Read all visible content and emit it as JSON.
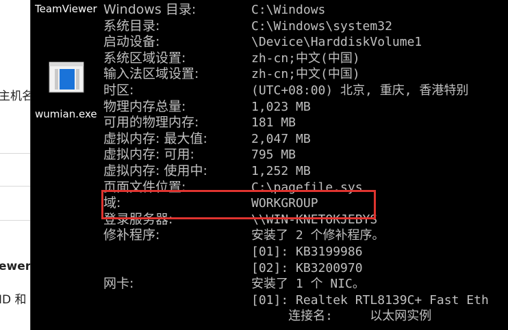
{
  "left_panel": {
    "snippets": [
      "主机名",
      "ewer",
      "ID 和"
    ]
  },
  "desktop": {
    "teamviewer_label": "TeamViewer",
    "exe_label": "wumian.exe",
    "exe_icon": "exe-window-icon"
  },
  "console": {
    "rows": [
      {
        "label": "Windows 目录:",
        "value": "C:\\Windows"
      },
      {
        "label": "系统目录:",
        "value": "C:\\Windows\\system32"
      },
      {
        "label": "启动设备:",
        "value": "\\Device\\HarddiskVolume1"
      },
      {
        "label": "系统区域设置:",
        "value": "zh-cn;中文(中国)"
      },
      {
        "label": "输入法区域设置:",
        "value": "zh-cn;中文(中国)"
      },
      {
        "label": "时区:",
        "value": "(UTC+08:00) 北京, 重庆, 香港特别"
      },
      {
        "label": "物理内存总量:",
        "value": "1,023 MB"
      },
      {
        "label": "可用的物理内存:",
        "value": "181 MB"
      },
      {
        "label": "虚拟内存: 最大值:",
        "value": "2,047 MB"
      },
      {
        "label": "虚拟内存: 可用:",
        "value": "795 MB"
      },
      {
        "label": "虚拟内存: 使用中:",
        "value": "1,252 MB"
      },
      {
        "label": "页面文件位置:",
        "value": "C:\\pagefile.sys"
      },
      {
        "label": "域:",
        "value": "WORKGROUP"
      },
      {
        "label": "登录服务器:",
        "value": "\\\\WIN-KNETOKJEBYS"
      },
      {
        "label": "修补程序:",
        "value": "安装了 2 个修补程序。"
      },
      {
        "label": "",
        "value": "[01]: KB3199986"
      },
      {
        "label": "",
        "value": "[02]: KB3200970"
      },
      {
        "label": "网卡:",
        "value": "安装了 1 个 NIC。"
      },
      {
        "label": "",
        "value": "[01]: Realtek RTL8139C+ Fast Eth"
      },
      {
        "label": "",
        "value": "     连接名:     以太网实例"
      }
    ],
    "highlight_color": "#e0342f",
    "text_color": "#c0c0c0"
  }
}
